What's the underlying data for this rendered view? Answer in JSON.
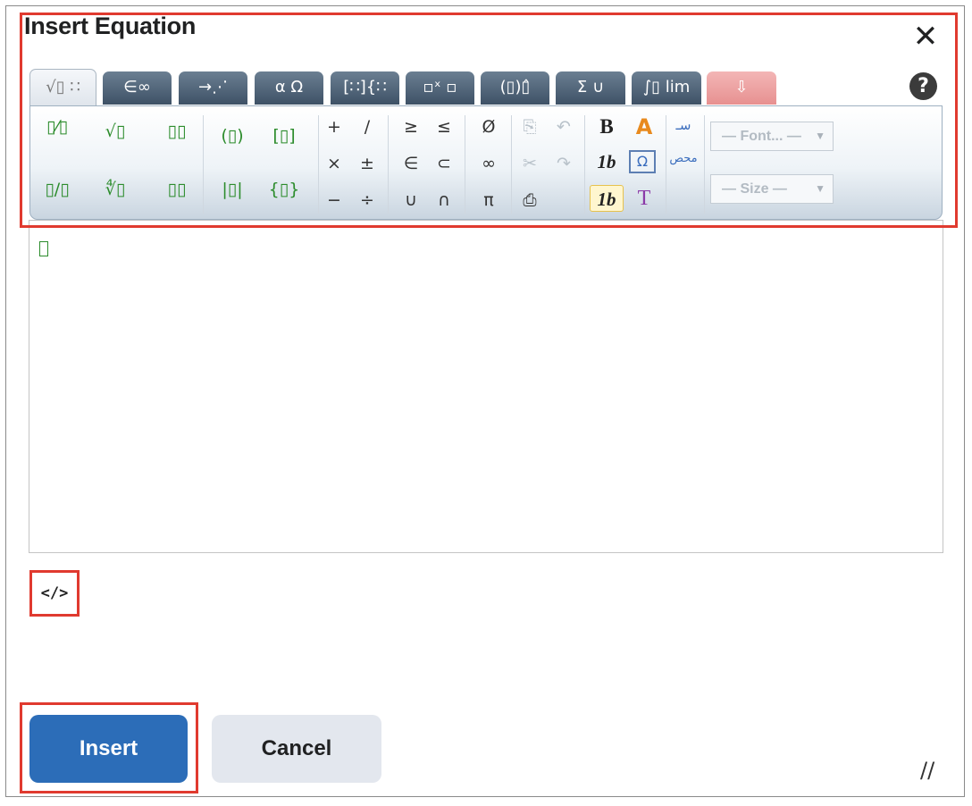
{
  "dialog": {
    "title": "Insert Equation",
    "close": "✕",
    "help": "?"
  },
  "tabs": [
    {
      "label": "√▯ ∷",
      "active": true
    },
    {
      "label": "∈∞"
    },
    {
      "label": "→⋰"
    },
    {
      "label": "α Ω"
    },
    {
      "label": "[∷]{∷"
    },
    {
      "label": "▫ˣ ▫"
    },
    {
      "label": "(▯)▯̂"
    },
    {
      "label": "Σ ∪"
    },
    {
      "label": "∫▯ lim"
    },
    {
      "label": "⇩"
    }
  ],
  "toolbar": {
    "fraction": "▯⁄▯",
    "sqrt": "√▯",
    "bevelled_fraction": "▯/▯",
    "nth_root": "∜▯",
    "superscript": "▯▯",
    "subscript": "▯▯",
    "parens": "(▯)",
    "abs": "|▯|",
    "brackets": "[▯]",
    "braces": "{▯}",
    "plus": "+",
    "slash": "/",
    "times": "×",
    "plusminus": "±",
    "minus": "−",
    "divide": "÷",
    "geq": "≥",
    "leq": "≤",
    "elem": "∈",
    "subset": "⊂",
    "union": "∪",
    "intersect": "∩",
    "empty": "Ø",
    "infinity": "∞",
    "pi": "π",
    "copy": "⎘",
    "undo": "↶",
    "cut": "✂",
    "redo": "↷",
    "paste": "⎙",
    "bold": "B",
    "color": "A",
    "italic_b": "1b",
    "special_chars": "Ω",
    "mathvariant": "1b",
    "text_mode": "T",
    "rtl": "سـ",
    "rtl2": "محص",
    "font_placeholder": "— Font... —",
    "size_placeholder": "— Size —"
  },
  "editor": {
    "placeholder_box": ""
  },
  "source_toggle": "</>",
  "buttons": {
    "insert": "Insert",
    "cancel": "Cancel"
  },
  "resize_grip": "//",
  "colors": {
    "highlight": "#e03a2f",
    "primary": "#2c6db8",
    "placeholder_green": "#2c8c2c"
  }
}
